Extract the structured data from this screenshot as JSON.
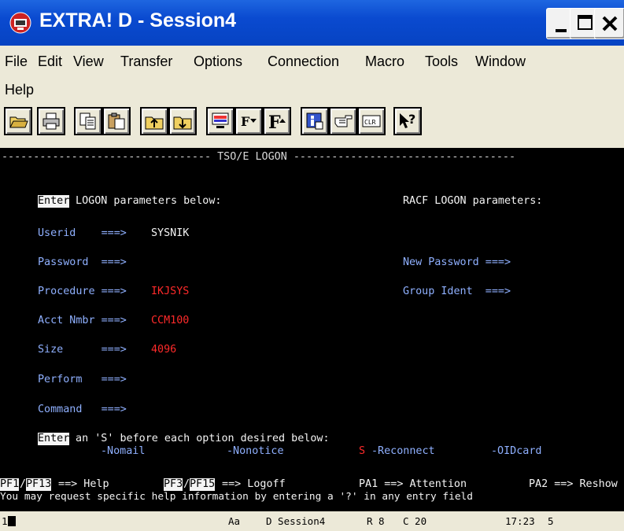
{
  "window": {
    "title": "EXTRA! D - Session4"
  },
  "menu": [
    "File",
    "Edit",
    "View",
    "Transfer",
    "Options",
    "Connection",
    "Macro",
    "Tools",
    "Window",
    "Help"
  ],
  "toolbar": {
    "buttons": [
      "open-icon",
      "print-icon",
      "copy-icon",
      "paste-icon",
      "send-file-icon",
      "receive-file-icon",
      "monitor-icon",
      "font-down-icon",
      "font-up-icon",
      "session-info-icon",
      "pointer-hand-icon",
      "clear-icon",
      "help-icon"
    ],
    "clr_label": "CLR",
    "font_down_label": "F",
    "font_up_label": "F"
  },
  "terminal": {
    "header": "--------------------------------- TSO/E LOGON -----------------------------------",
    "enter_word": "Enter",
    "logon_params": " LOGON parameters below:",
    "racf_params": "RACF LOGON parameters:",
    "userid_label": "Userid    ===>",
    "userid_value": "SYSNIK",
    "password_label": "Password  ===>",
    "new_password_label": "New Password ===>",
    "procedure_label": "Procedure ===>",
    "procedure_value": "IKJSYS",
    "group_ident_label": "Group Ident  ===>",
    "acct_label": "Acct Nmbr ===>",
    "acct_value": "CCM100",
    "size_label": "Size      ===>",
    "size_value": "4096",
    "perform_label": "Perform   ===>",
    "command_label": "Command   ===>",
    "option_prompt": " an 'S' before each option desired below:",
    "nomail": "-Nomail",
    "nonotice": "-Nonotice",
    "reconnect_mark": "S",
    "reconnect": "-Reconnect",
    "oidcard": "-OIDcard",
    "pf1": "PF1",
    "pf13": "PF13",
    "pf_help": " ==> Help",
    "pf3": "PF3",
    "pf15": "PF15",
    "pf_logoff": " ==> Logoff",
    "pa1": "PA1 ==> Attention",
    "pa2": "PA2 ==> Reshow",
    "help_line": "You may request specific help information by entering a '?' in any entry field"
  },
  "status": {
    "indicator": "1",
    "font": "Aa",
    "session": "D Session4",
    "row": "R 8",
    "col": "C 20",
    "time": "17:23",
    "count": "5"
  },
  "colors": {
    "title_blue": "#0a4ad0",
    "field_blue": "#8fb0ff",
    "value_red": "#ff2a2a",
    "terminal_bg": "#000000"
  }
}
